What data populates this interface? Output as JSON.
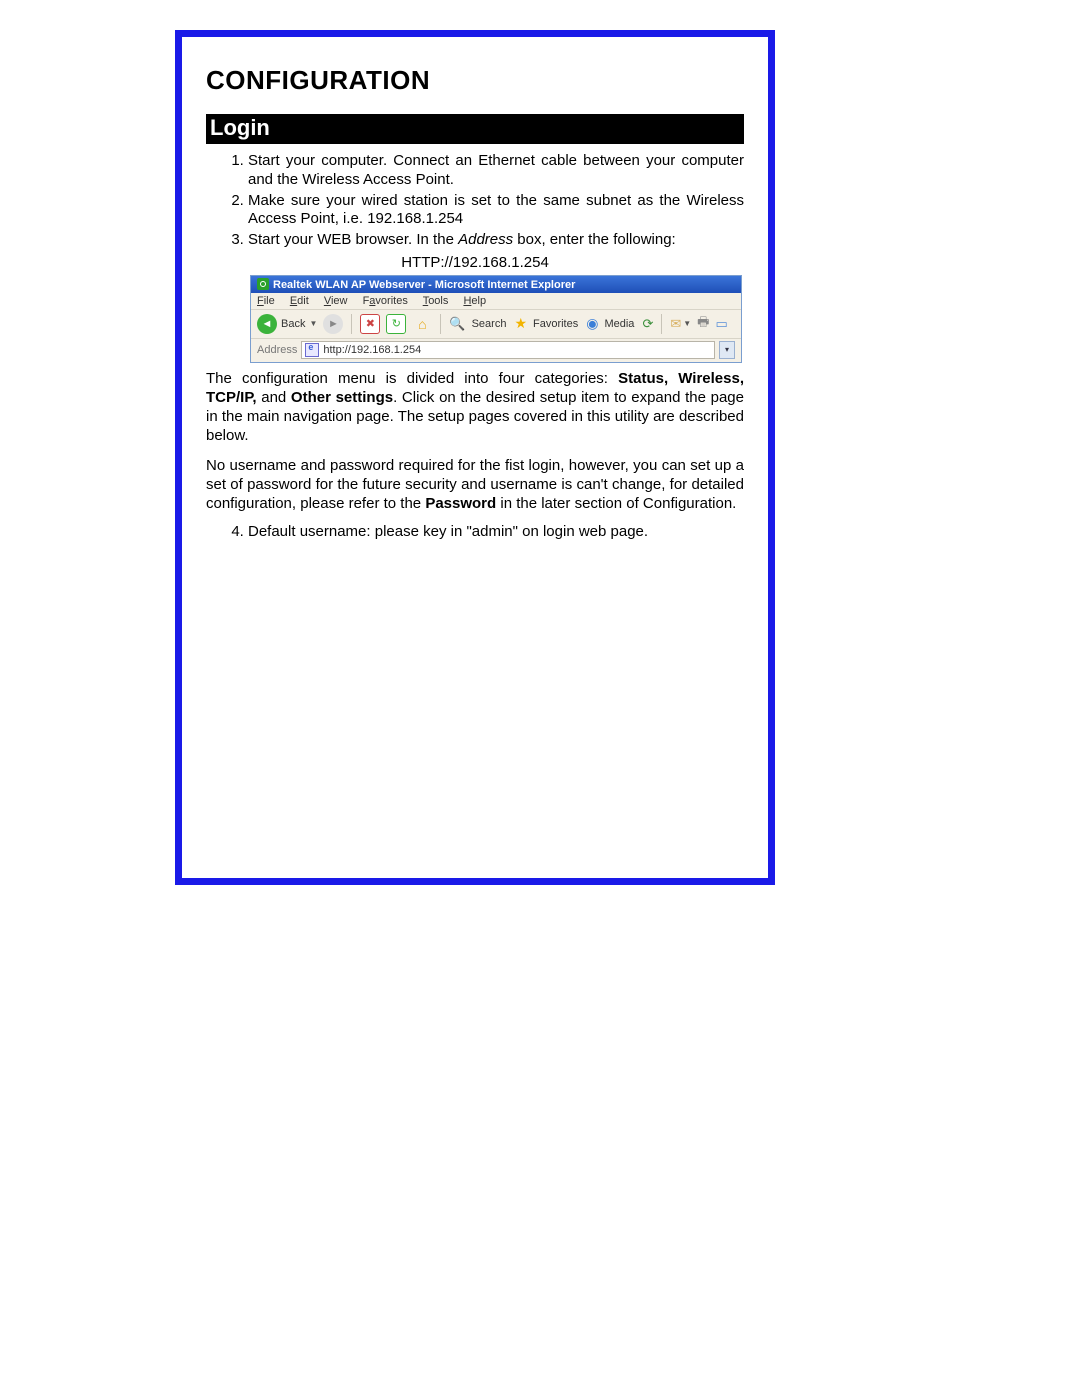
{
  "title": "CONFIGURATION",
  "section": "Login",
  "steps": {
    "s1": "Start your computer. Connect an Ethernet cable between your computer and the Wireless Access Point.",
    "s2": "Make sure your wired station is set to the same subnet as the Wireless Access Point, i.e. 192.168.1.254",
    "s3_prefix": "Start your WEB browser. In the ",
    "s3_address_word": "Address",
    "s3_suffix": " box, enter the following:",
    "s4": "Default username: please key in \"admin\" on login web page."
  },
  "url_line": "HTTP://192.168.1.254",
  "browser": {
    "title": "Realtek WLAN AP Webserver - Microsoft Internet Explorer",
    "menu": {
      "file": "File",
      "edit": "Edit",
      "view": "View",
      "favorites": "Favorites",
      "tools": "Tools",
      "help": "Help"
    },
    "toolbar": {
      "back": "Back",
      "search": "Search",
      "favorites": "Favorites",
      "media": "Media"
    },
    "address_label": "Address",
    "address_value": "http://192.168.1.254"
  },
  "para1": {
    "p1": "The configuration menu is divided into four categories: ",
    "b1": "Status, Wireless, TCP/IP,",
    "p2": " and ",
    "b2": "Other settings",
    "p3": ". Click on the desired setup item to expand the page in the main navigation page. The setup pages covered in this utility are described below."
  },
  "para2": {
    "p1": "No username and password required for the fist login, however, you can set up a set of password for the future security and username is can't change, for detailed configuration, please refer to the ",
    "b1": "Password",
    "p2": " in the later section of Configuration."
  }
}
